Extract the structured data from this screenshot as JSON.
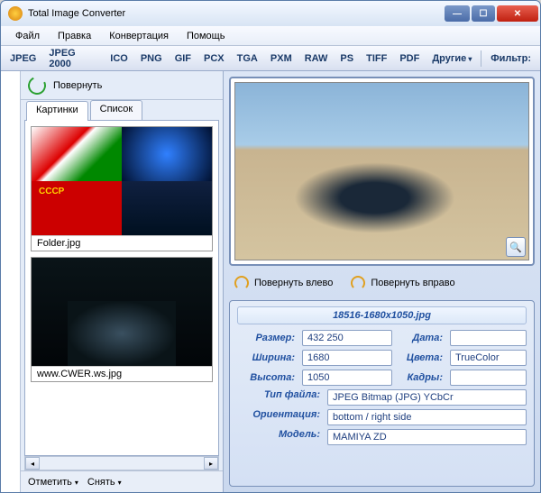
{
  "window": {
    "title": "Total Image Converter"
  },
  "menu": {
    "file": "Файл",
    "edit": "Правка",
    "convert": "Конвертация",
    "help": "Помощь"
  },
  "formats": [
    "JPEG",
    "JPEG 2000",
    "ICO",
    "PNG",
    "GIF",
    "PCX",
    "TGA",
    "PXM",
    "RAW",
    "PS",
    "TIFF",
    "PDF"
  ],
  "formats_other": "Другие",
  "filter_label": "Фильтр:",
  "left": {
    "rotate": "Повернуть",
    "tabs": {
      "pics": "Картинки",
      "list": "Список"
    },
    "thumb1": "Folder.jpg",
    "thumb2": "www.CWER.ws.jpg",
    "mark": "Отметить",
    "unmark": "Снять"
  },
  "rot": {
    "left": "Повернуть влево",
    "right": "Повернуть вправо"
  },
  "info": {
    "filename": "18516-1680x1050.jpg",
    "size_l": "Размер:",
    "size_v": "432 250",
    "date_l": "Дата:",
    "date_v": "",
    "width_l": "Ширина:",
    "width_v": "1680",
    "colors_l": "Цвета:",
    "colors_v": "TrueColor",
    "height_l": "Высота:",
    "height_v": "1050",
    "frames_l": "Кадры:",
    "frames_v": "",
    "type_l": "Тип файла:",
    "type_v": "JPEG Bitmap (JPG) YCbCr",
    "orient_l": "Ориентация:",
    "orient_v": "bottom / right side",
    "model_l": "Модель:",
    "model_v": "MAMIYA ZD"
  }
}
